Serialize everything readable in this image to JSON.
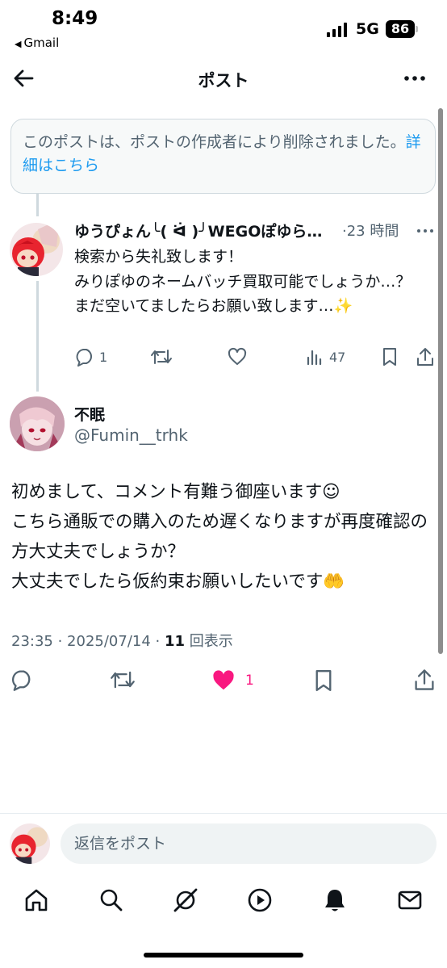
{
  "status_bar": {
    "time": "8:49",
    "back_app": "Gmail",
    "network": "5G",
    "battery": "86"
  },
  "header": {
    "title": "ポスト"
  },
  "deleted_notice": {
    "text": "このポストは、ポストの作成者により削除されました。",
    "link": "詳細はこちら"
  },
  "reply_tweet": {
    "display_name": "ゆうぴょん╰( ᐛ )╯WEGOぽゆら…",
    "time": "23 時間",
    "body_lines": [
      "検索から失礼致します！",
      "みりぽゆのネームバッチ買取可能でしょうか…？",
      "まだ空いてましたらお願い致します…✨"
    ],
    "reply_count": "1",
    "view_count": "47"
  },
  "main_tweet": {
    "display_name": "不眠",
    "handle": "@Fumin__trhk",
    "body_lines": [
      "初めまして、コメント有難う御座います☺︎",
      "こちら通販での購入のため遅くなりますが再度確認の方大丈夫でしょうか？",
      "大丈夫でしたら仮約束お願いしたいです🤲"
    ],
    "time": "23:35",
    "date": "2025/07/14",
    "view_count": "11",
    "view_label": "回表示",
    "like_count": "1"
  },
  "composer": {
    "placeholder": "返信をポスト"
  },
  "colors": {
    "text": "#0f1419",
    "secondary": "#536471",
    "link": "#1d9bf0",
    "like": "#f91880"
  }
}
